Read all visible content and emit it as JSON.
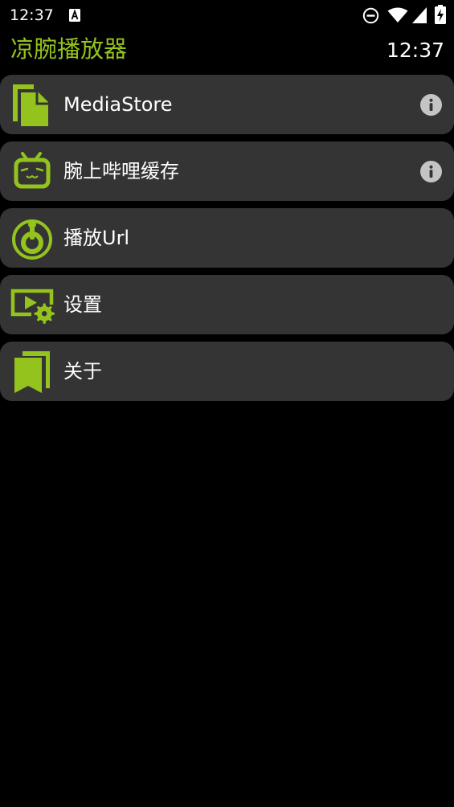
{
  "status_bar": {
    "time": "12:37",
    "icons": [
      "keyboard-a-icon",
      "do-not-disturb-icon",
      "wifi-icon",
      "cellular-signal-icon",
      "battery-charging-icon"
    ]
  },
  "header": {
    "title": "凉腕播放器",
    "clock": "12:37"
  },
  "menu": {
    "items": [
      {
        "label": "MediaStore",
        "icon": "file-copy-icon",
        "has_info": true
      },
      {
        "label": "腕上哔哩缓存",
        "icon": "bilibili-tv-icon",
        "has_info": true
      },
      {
        "label": "播放Url",
        "icon": "joystick-icon",
        "has_info": false
      },
      {
        "label": "设置",
        "icon": "video-settings-icon",
        "has_info": false
      },
      {
        "label": "关于",
        "icon": "bookmarks-icon",
        "has_info": false
      }
    ]
  },
  "colors": {
    "accent": "#95c31e",
    "background": "#000000",
    "card": "#343434",
    "info_icon": "#c4c4c4"
  }
}
